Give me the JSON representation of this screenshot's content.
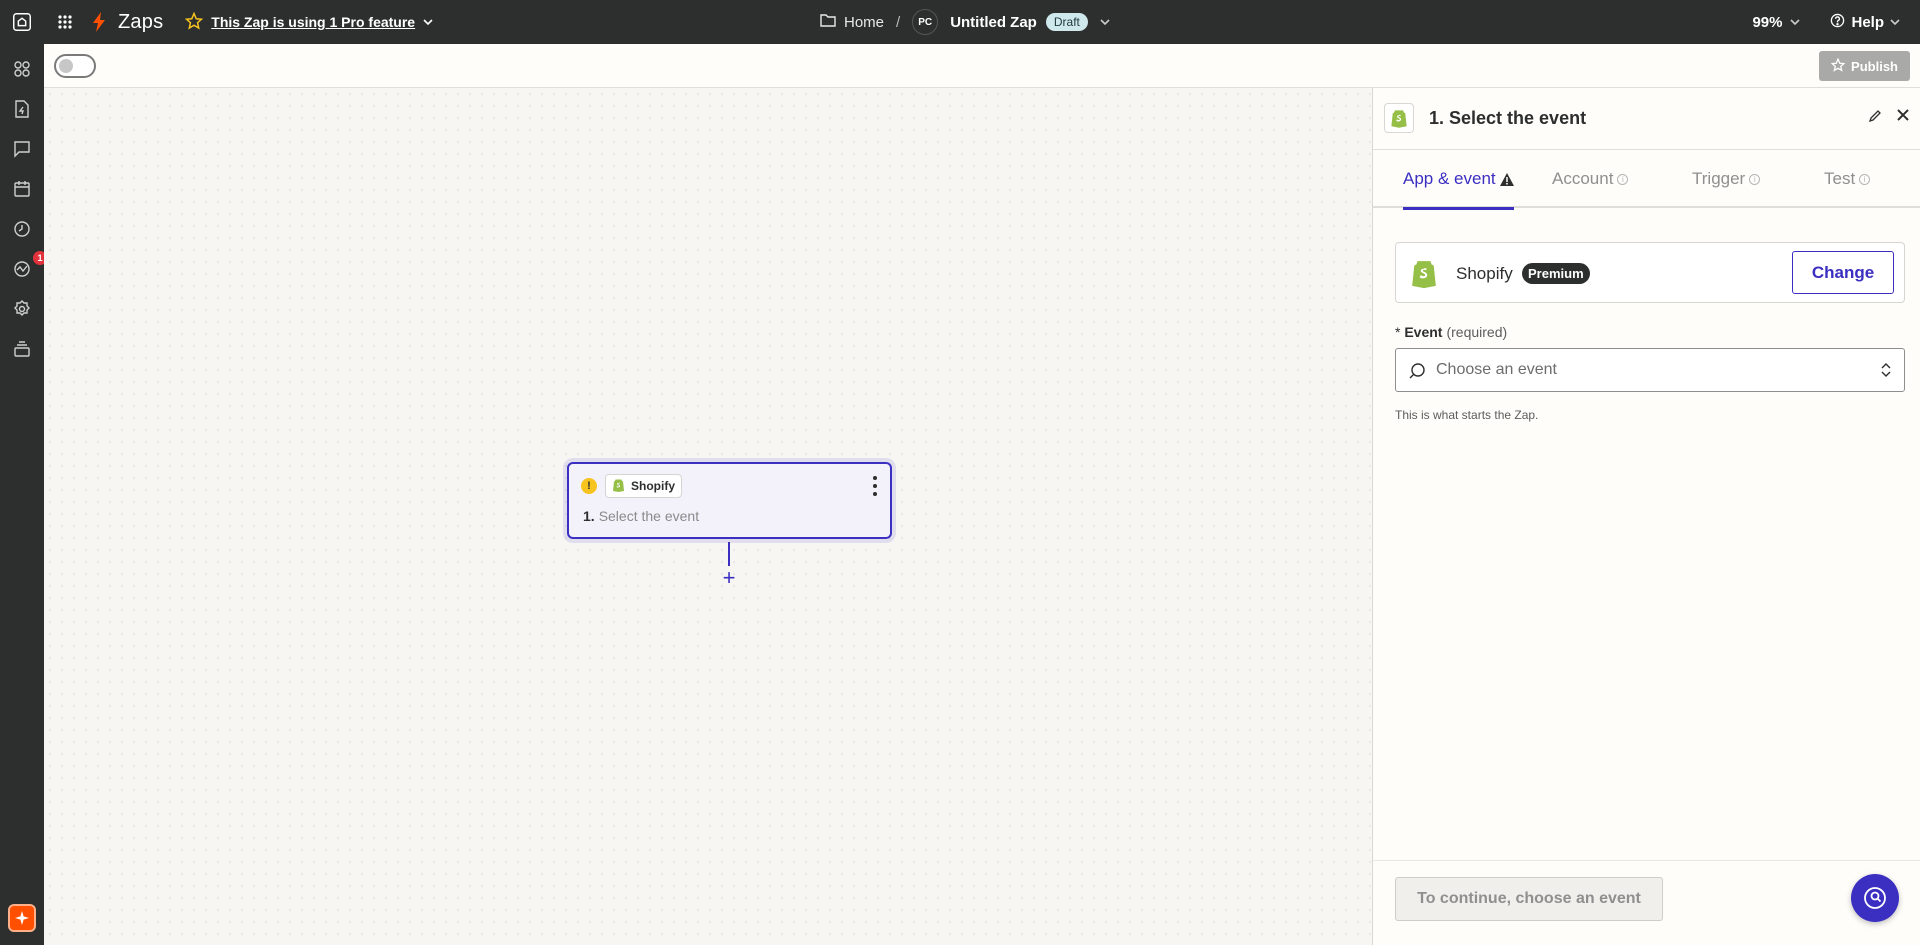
{
  "topbar": {
    "brand": "Zaps",
    "pro_feature": "This Zap is using 1 Pro feature",
    "breadcrumb_home": "Home",
    "breadcrumb_sep": "/",
    "avatar_initials": "PC",
    "zap_title": "Untitled Zap",
    "status_badge": "Draft",
    "zoom": "99%",
    "help": "Help"
  },
  "rail": {
    "items": [
      "apps-icon",
      "zap-file-icon",
      "chat-icon",
      "calendar-icon",
      "history-icon",
      "activity-icon",
      "settings-icon",
      "layers-icon"
    ],
    "badge_count": "1"
  },
  "toolbar": {
    "publish_label": "Publish"
  },
  "node": {
    "app": "Shopify",
    "step_number": "1.",
    "step_label": "Select the event",
    "add_symbol": "+"
  },
  "panel": {
    "title": "1. Select the event",
    "tabs": [
      {
        "label": "App & event"
      },
      {
        "label": "Account"
      },
      {
        "label": "Trigger"
      },
      {
        "label": "Test"
      }
    ],
    "app_name": "Shopify",
    "premium_badge": "Premium",
    "change_label": "Change",
    "event_asterisk": "*",
    "event_label": "Event",
    "event_required": "(required)",
    "event_placeholder": "Choose an event",
    "hint": "This is what starts the Zap.",
    "continue_label": "To continue, choose an event"
  },
  "colors": {
    "accent": "#3b2fc2",
    "brand_orange": "#ff4f00",
    "shopify_green": "#95bf47",
    "topbar_bg": "#2d2e2e"
  }
}
